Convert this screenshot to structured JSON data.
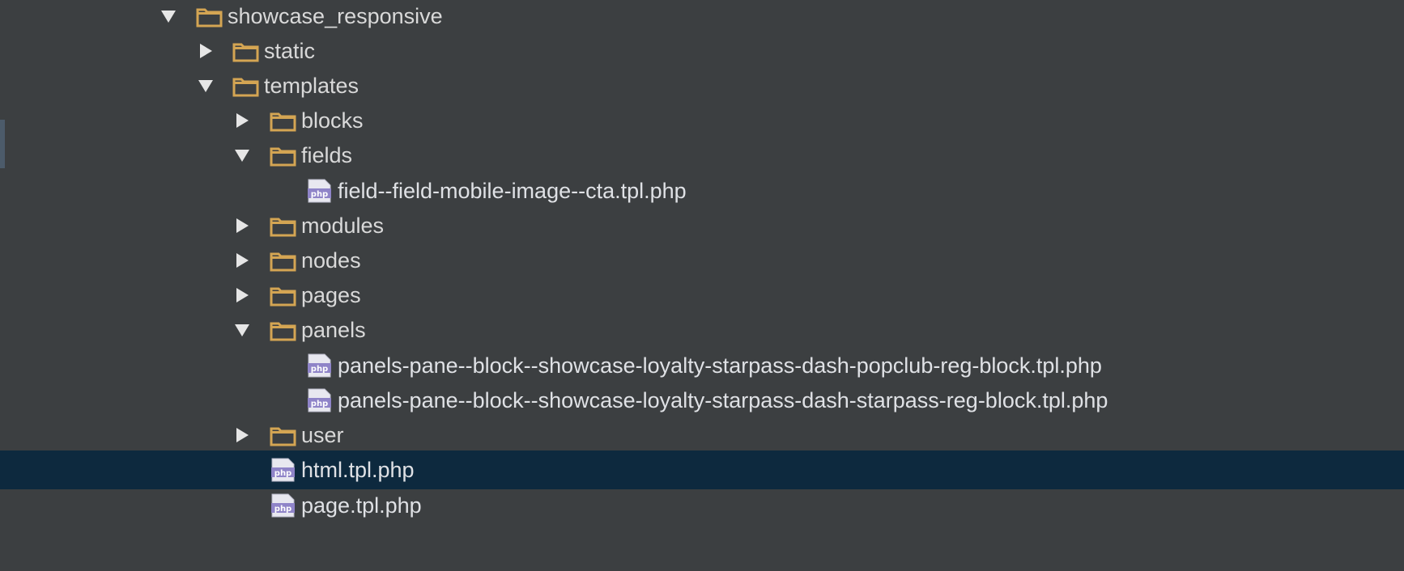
{
  "colors": {
    "background": "#3c3f41",
    "selection": "#0d293e",
    "folder": "#d4a553",
    "text": "#d9d9d9",
    "php_icon": "#8f84c8"
  },
  "tree": {
    "showcase_responsive": {
      "label": "showcase_responsive",
      "icon": "folder-icon",
      "expanded": true
    },
    "static": {
      "label": "static",
      "icon": "folder-icon",
      "expanded": false
    },
    "templates": {
      "label": "templates",
      "icon": "folder-icon",
      "expanded": true
    },
    "blocks": {
      "label": "blocks",
      "icon": "folder-icon",
      "expanded": false
    },
    "fields": {
      "label": "fields",
      "icon": "folder-icon",
      "expanded": true
    },
    "field_file": {
      "label": "field--field-mobile-image--cta.tpl.php",
      "icon": "php-file-icon",
      "icon_text": "php"
    },
    "modules": {
      "label": "modules",
      "icon": "folder-icon",
      "expanded": false
    },
    "nodes": {
      "label": "nodes",
      "icon": "folder-icon",
      "expanded": false
    },
    "pages": {
      "label": "pages",
      "icon": "folder-icon",
      "expanded": false
    },
    "panels": {
      "label": "panels",
      "icon": "folder-icon",
      "expanded": true
    },
    "panels_file_1": {
      "label": "panels-pane--block--showcase-loyalty-starpass-dash-popclub-reg-block.tpl.php",
      "icon": "php-file-icon",
      "icon_text": "php"
    },
    "panels_file_2": {
      "label": "panels-pane--block--showcase-loyalty-starpass-dash-starpass-reg-block.tpl.php",
      "icon": "php-file-icon",
      "icon_text": "php"
    },
    "user": {
      "label": "user",
      "icon": "folder-icon",
      "expanded": false
    },
    "html_tpl": {
      "label": "html.tpl.php",
      "icon": "php-file-icon",
      "icon_text": "php",
      "selected": true
    },
    "page_tpl": {
      "label": "page.tpl.php",
      "icon": "php-file-icon",
      "icon_text": "php"
    }
  }
}
